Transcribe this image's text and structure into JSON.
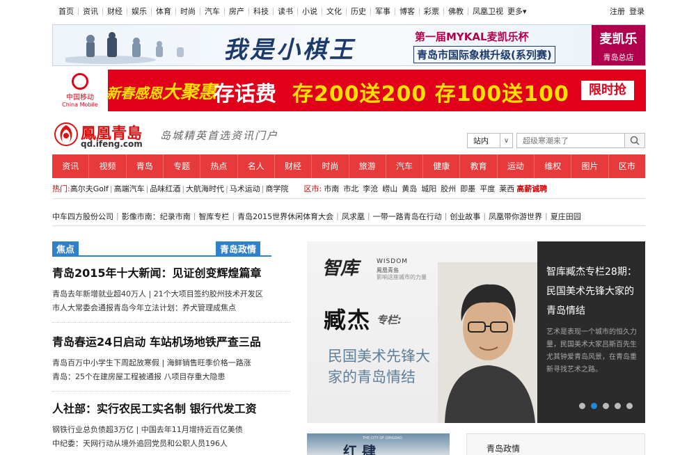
{
  "topbar": {
    "nav": [
      "首页",
      "资讯",
      "财经",
      "娱乐",
      "体育",
      "时尚",
      "汽车",
      "房产",
      "科技",
      "读书",
      "小说",
      "文化",
      "历史",
      "军事",
      "博客",
      "彩票",
      "佛教",
      "凤凰卫视"
    ],
    "more": "更多",
    "register": "注册",
    "login": "登录"
  },
  "banner1": {
    "title": "我是小棋王",
    "line1": "第一届MYKAL麦凯乐杯",
    "line2": "青岛市国际象棋升级(系列赛)",
    "brand": "麦凯乐",
    "brand_sub": "青岛总店"
  },
  "banner2": {
    "logo_cn": "中国移动",
    "logo_en": "China Mobile",
    "promo_a1": "新春感恩",
    "promo_a2": "大聚惠",
    "promo_b": "存话费",
    "promo_c": "存200送200 存100送100",
    "promo_d": "限时抢"
  },
  "header": {
    "logo_name": "鳳凰青島",
    "logo_url": "qd.ifeng.com",
    "slogan": "岛城精英首选资讯门户",
    "site_select": "站内",
    "search_placeholder": "超级寒潮来了"
  },
  "mainnav": [
    "资讯",
    "视频",
    "青岛",
    "专题",
    "热点",
    "名人",
    "财经",
    "时尚",
    "旅游",
    "汽车",
    "健康",
    "教育",
    "运动",
    "维权",
    "图片",
    "区市"
  ],
  "hotrow": {
    "label": "热门:",
    "items": [
      "高尔夫Golf",
      "高端汽车",
      "品味红酒",
      "大航海时代",
      "马术运动",
      "商学院"
    ],
    "area_label": "区市:",
    "areas": [
      "市南",
      "市北",
      "李沧",
      "崂山",
      "黄岛",
      "城阳",
      "胶州",
      "即墨",
      "平度",
      "莱西"
    ],
    "recruit": "高薪诚聘"
  },
  "linkrow": [
    "中车四方股份公司",
    "影像市南：纪录市南",
    "智库专栏",
    "青岛2015世界休闲体育大会",
    "凤求凰",
    "一带一路青岛在行动",
    "创业故事",
    "凤凰带你游世界",
    "夏庄田园"
  ],
  "tabs": {
    "focus": "焦点",
    "gov": "青岛政情"
  },
  "news": [
    {
      "title": "青岛2015年十大新闻：见证创变辉煌篇章",
      "lines": [
        "青岛去年新增就业超40万人 | 21个大项目签约胶州技术开发区",
        "市人大常委会通报青岛今年立法计划：养犬管理成焦点"
      ]
    },
    {
      "title": "青岛春运24日启动 车站机场地铁严查三品",
      "lines": [
        "青岛百万中小学生下周起放寒假 | 海鲜销售旺季价格一路涨",
        "青岛：25个在建房屋工程被通报 八项目存重大隐患"
      ]
    },
    {
      "title": "人社部：实行农民工实名制 银行代发工资",
      "lines": [
        "钢铁行业总负债超3万亿 | 中国去年11月增持近百亿美债",
        "中纪委：天网行动从境外追回党员和公职人员196人"
      ]
    }
  ],
  "slide": {
    "zk": "智库",
    "wisdom": "WISDOM",
    "wisdom2": "鳳凰青島",
    "wisdom3": "影响这座城市的力量",
    "name": "臧杰",
    "column": "专栏:",
    "subtitle": "民国美术先锋大家的青岛情结",
    "side_title": "智库臧杰专栏28期：民国美术先锋大家的青岛情结",
    "side_desc": "艺术是表现一个城市的恒久力量，民国美术大家吕斯百先生尤其钟爱青岛风景，在青岛重新寻找艺术之路。",
    "dots": 5,
    "active_dot": 2
  },
  "bottom": {
    "thumb_line": "THE CITY OF QINGDAO",
    "thumb_big": "红 肆",
    "gov_label": "青岛政情"
  }
}
